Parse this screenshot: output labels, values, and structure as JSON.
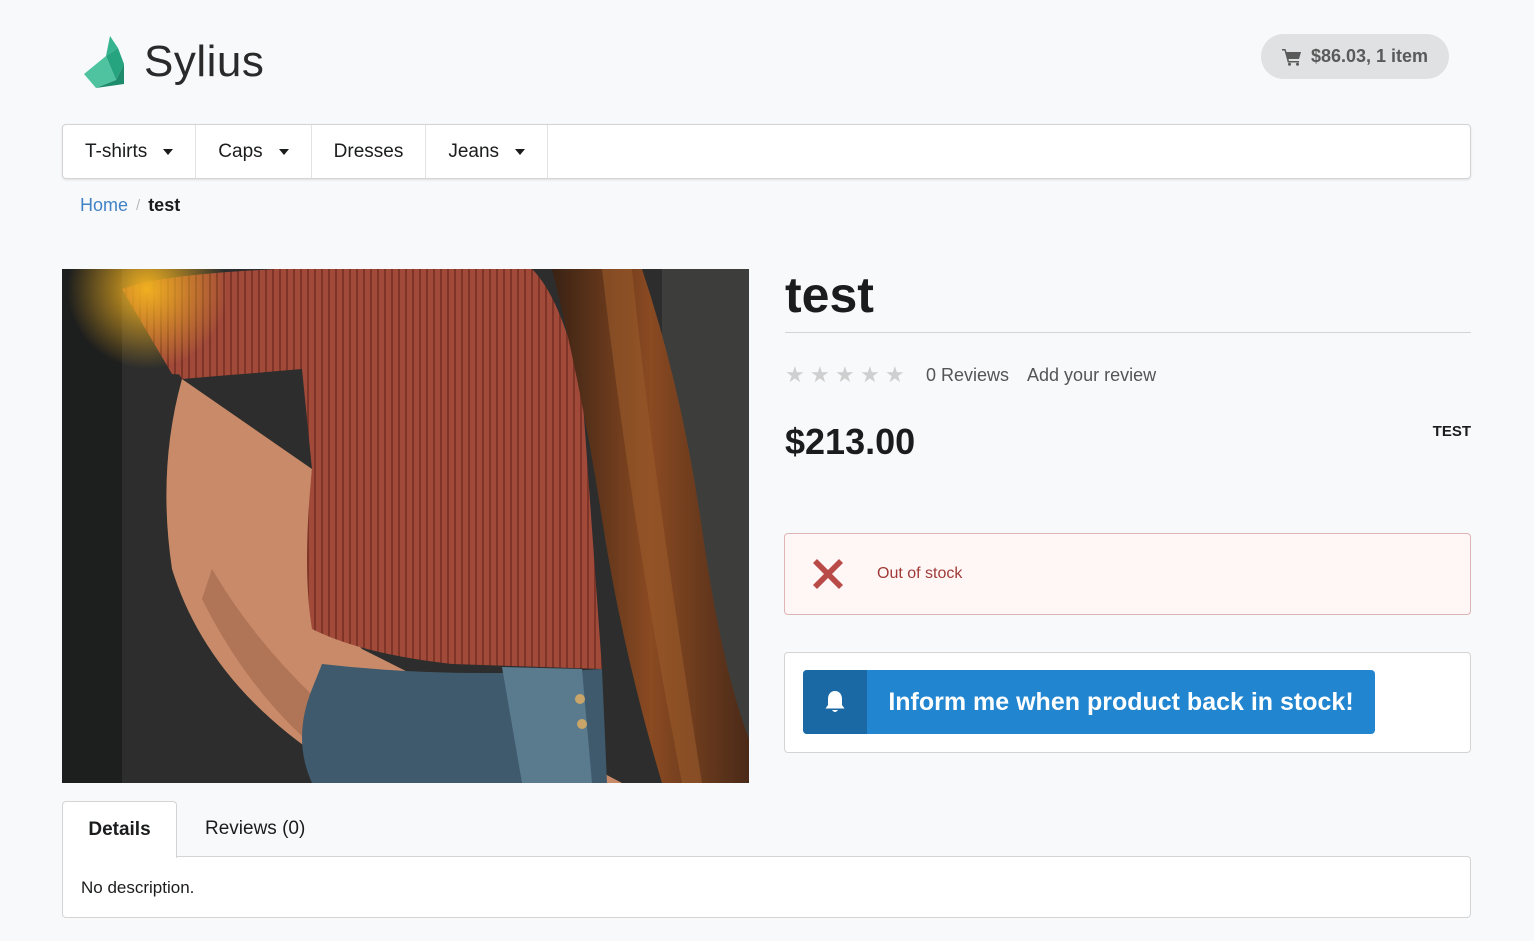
{
  "header": {
    "logo_text": "Sylius",
    "cart_summary": "$86.03, 1 item"
  },
  "menu": {
    "items": [
      {
        "label": "T-shirts",
        "has_dropdown": true
      },
      {
        "label": "Caps",
        "has_dropdown": true
      },
      {
        "label": "Dresses",
        "has_dropdown": false
      },
      {
        "label": "Jeans",
        "has_dropdown": true
      }
    ]
  },
  "breadcrumb": {
    "home": "Home",
    "separator": "/",
    "current": "test"
  },
  "product": {
    "title": "test",
    "rating_stars": 0,
    "rating_max": 5,
    "reviews_label": "0 Reviews",
    "add_review_label": "Add your review",
    "price": "$213.00",
    "code": "TEST",
    "stock_message": "Out of stock",
    "notify_button_label": "Inform me when product back in stock!"
  },
  "tabs": {
    "details_label": "Details",
    "reviews_label": "Reviews (0)",
    "details_content": "No description."
  },
  "colors": {
    "accent_blue": "#2185d0",
    "link_blue": "#4183c4",
    "error_text": "#9f3a38",
    "error_bg": "#fff6f6",
    "logo_green": "#1abb9c"
  }
}
